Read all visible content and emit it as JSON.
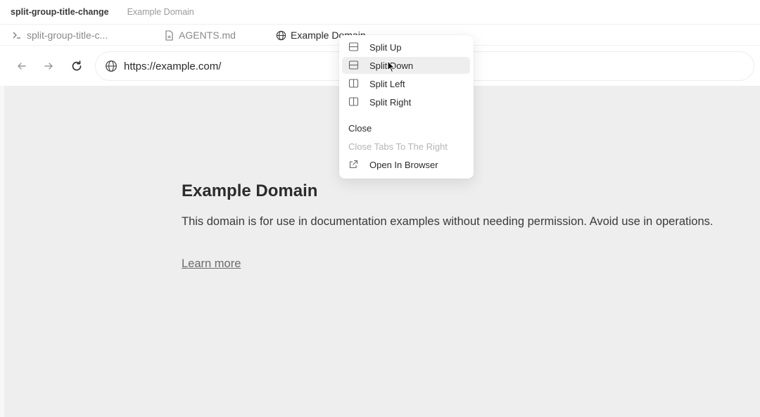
{
  "window": {
    "title": "split-group-title-change",
    "subtitle": "Example Domain"
  },
  "tabs": [
    {
      "label": "split-group-title-c...",
      "icon": "terminal-icon"
    },
    {
      "label": "AGENTS.md",
      "icon": "file-icon"
    },
    {
      "label": "Example Domain",
      "icon": "globe-icon",
      "active": true
    }
  ],
  "navbar": {
    "url": "https://example.com/"
  },
  "page": {
    "title": "Example Domain",
    "body": "This domain is for use in documentation examples without needing permission. Avoid use in operations.",
    "link": "Learn more"
  },
  "context_menu": {
    "items": [
      {
        "label": "Split Up",
        "icon": "split-horizontal-icon"
      },
      {
        "label": "Split Down",
        "icon": "split-horizontal-icon",
        "hovered": true
      },
      {
        "label": "Split Left",
        "icon": "split-vertical-icon"
      },
      {
        "label": "Split Right",
        "icon": "split-vertical-icon"
      },
      {
        "label": "Close"
      },
      {
        "label": "Close Tabs To The Right",
        "disabled": true
      },
      {
        "label": "Open In Browser",
        "icon": "external-link-icon"
      }
    ]
  },
  "colors": {
    "content_bg": "#eeeeee",
    "menu_hover": "#eeeeee",
    "disabled_text": "#b5b5b5"
  }
}
